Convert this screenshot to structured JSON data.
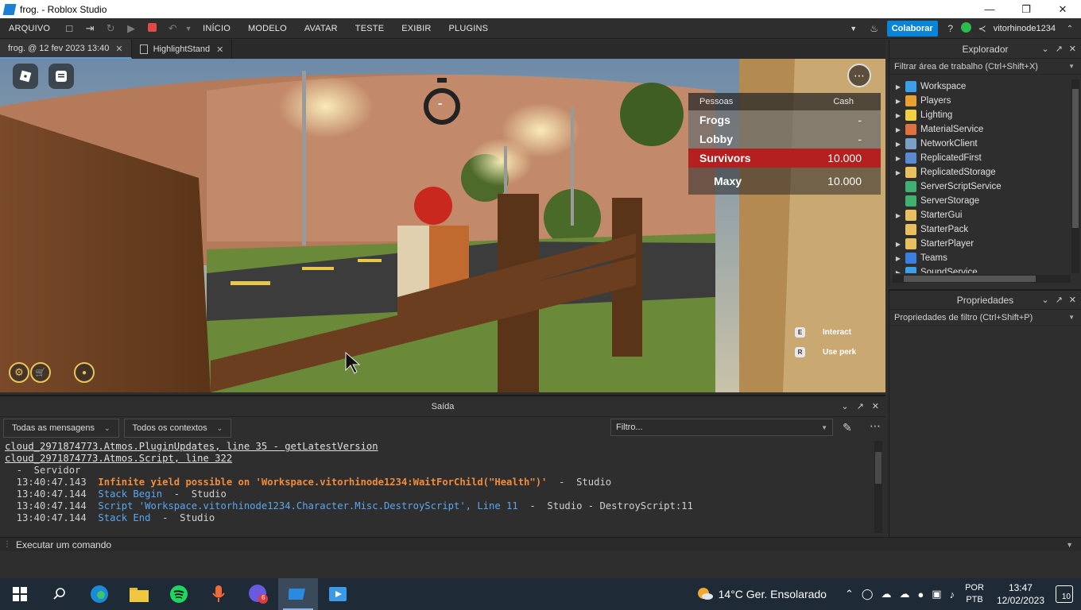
{
  "window": {
    "title": "frog. - Roblox Studio",
    "minimize": "—",
    "maximize": "❐",
    "close": "✕"
  },
  "menubar": {
    "file": "ARQUIVO",
    "menus": [
      "INÍCIO",
      "MODELO",
      "AVATAR",
      "TESTE",
      "EXIBIR",
      "PLUGINS"
    ],
    "collaborate": "Colaborar",
    "username": "vitorhinode1234"
  },
  "tabs": [
    {
      "label": "frog. @ 12 fev 2023 13:40",
      "close": "✕"
    },
    {
      "label": "HighlightStand",
      "close": "✕"
    }
  ],
  "game": {
    "timer": "-",
    "leaderboard": {
      "col_name": "Pessoas",
      "col_value": "Cash",
      "rows": [
        {
          "name": "Frogs",
          "value": "-",
          "kind": "team",
          "color": "#8a8a8a"
        },
        {
          "name": "Lobby",
          "value": "-",
          "kind": "team",
          "color": "#8a8a8a"
        },
        {
          "name": "Survivors",
          "value": "10.000",
          "kind": "team",
          "color": "#b4201f"
        },
        {
          "name": "Maxy",
          "value": "10.000",
          "kind": "player"
        }
      ]
    },
    "hints": [
      {
        "key": "E",
        "label": "Interact"
      },
      {
        "key": "R",
        "label": "Use perk"
      }
    ],
    "menu_dots": "⋯"
  },
  "output": {
    "title": "Saída",
    "filter_messages": "Todas as mensagens",
    "filter_contexts": "Todos os contextos",
    "filter_placeholder": "Filtro...",
    "lines": [
      {
        "segments": [
          {
            "text": "cloud_2971874773.Atmos.PluginUpdates, line 35 - getLatestVersion",
            "style": "link"
          }
        ]
      },
      {
        "segments": [
          {
            "text": "cloud_2971874773.Atmos.Script, line 322",
            "style": "link"
          }
        ]
      },
      {
        "segments": [
          {
            "text": "  -  Servidor",
            "style": "plain"
          }
        ]
      },
      {
        "segments": [
          {
            "text": "  13:40:47.143  ",
            "style": "plain"
          },
          {
            "text": "Infinite yield possible on 'Workspace.vitorhinode1234:WaitForChild(\"Health\")'",
            "style": "warn"
          },
          {
            "text": "  -  Studio",
            "style": "studio"
          }
        ]
      },
      {
        "segments": [
          {
            "text": "  13:40:47.144  ",
            "style": "plain"
          },
          {
            "text": "Stack Begin",
            "style": "info"
          },
          {
            "text": "  -  Studio",
            "style": "studio"
          }
        ]
      },
      {
        "segments": [
          {
            "text": "  13:40:47.144  ",
            "style": "plain"
          },
          {
            "text": "Script 'Workspace.vitorhinode1234.Character.Misc.DestroyScript', Line 11",
            "style": "info"
          },
          {
            "text": "  -  Studio - DestroyScript:11",
            "style": "studio"
          }
        ]
      },
      {
        "segments": [
          {
            "text": "  13:40:47.144  ",
            "style": "plain"
          },
          {
            "text": "Stack End",
            "style": "info"
          },
          {
            "text": "  -  Studio",
            "style": "studio"
          }
        ]
      }
    ]
  },
  "command_bar": {
    "placeholder": "Executar um comando"
  },
  "explorer": {
    "title": "Explorador",
    "filter": "Filtrar área de trabalho (Ctrl+Shift+X)",
    "items": [
      {
        "label": "Workspace",
        "expandable": true,
        "icon": "globe-icon",
        "color": "#3aa0e8"
      },
      {
        "label": "Players",
        "expandable": true,
        "icon": "players-icon",
        "color": "#e8a030"
      },
      {
        "label": "Lighting",
        "expandable": true,
        "icon": "lightbulb-icon",
        "color": "#f0d040"
      },
      {
        "label": "MaterialService",
        "expandable": true,
        "icon": "material-icon",
        "color": "#e07040"
      },
      {
        "label": "NetworkClient",
        "expandable": true,
        "icon": "network-icon",
        "color": "#7aa0c8"
      },
      {
        "label": "ReplicatedFirst",
        "expandable": true,
        "icon": "replicated-first-icon",
        "color": "#5a8ad0"
      },
      {
        "label": "ReplicatedStorage",
        "expandable": true,
        "icon": "folder-icon",
        "color": "#e8c060"
      },
      {
        "label": "ServerScriptService",
        "expandable": false,
        "icon": "script-service-icon",
        "color": "#40b070"
      },
      {
        "label": "ServerStorage",
        "expandable": false,
        "icon": "server-storage-icon",
        "color": "#40b070"
      },
      {
        "label": "StarterGui",
        "expandable": true,
        "icon": "folder-icon",
        "color": "#e8c060"
      },
      {
        "label": "StarterPack",
        "expandable": false,
        "icon": "pack-icon",
        "color": "#e8c060"
      },
      {
        "label": "StarterPlayer",
        "expandable": true,
        "icon": "folder-icon",
        "color": "#e8c060"
      },
      {
        "label": "Teams",
        "expandable": true,
        "icon": "teams-icon",
        "color": "#3a80e0"
      },
      {
        "label": "SoundService",
        "expandable": true,
        "icon": "sound-icon",
        "color": "#3aa0e8"
      }
    ]
  },
  "properties": {
    "title": "Propriedades",
    "filter": "Propriedades de filtro (Ctrl+Shift+P)"
  },
  "taskbar": {
    "weather_temp": "14°C",
    "weather_desc": "Ger. Ensolarado",
    "lang_1": "POR",
    "lang_2": "PTB",
    "time": "13:47",
    "date": "12/02/2023",
    "notifications": "10",
    "discord_badge": "6"
  }
}
